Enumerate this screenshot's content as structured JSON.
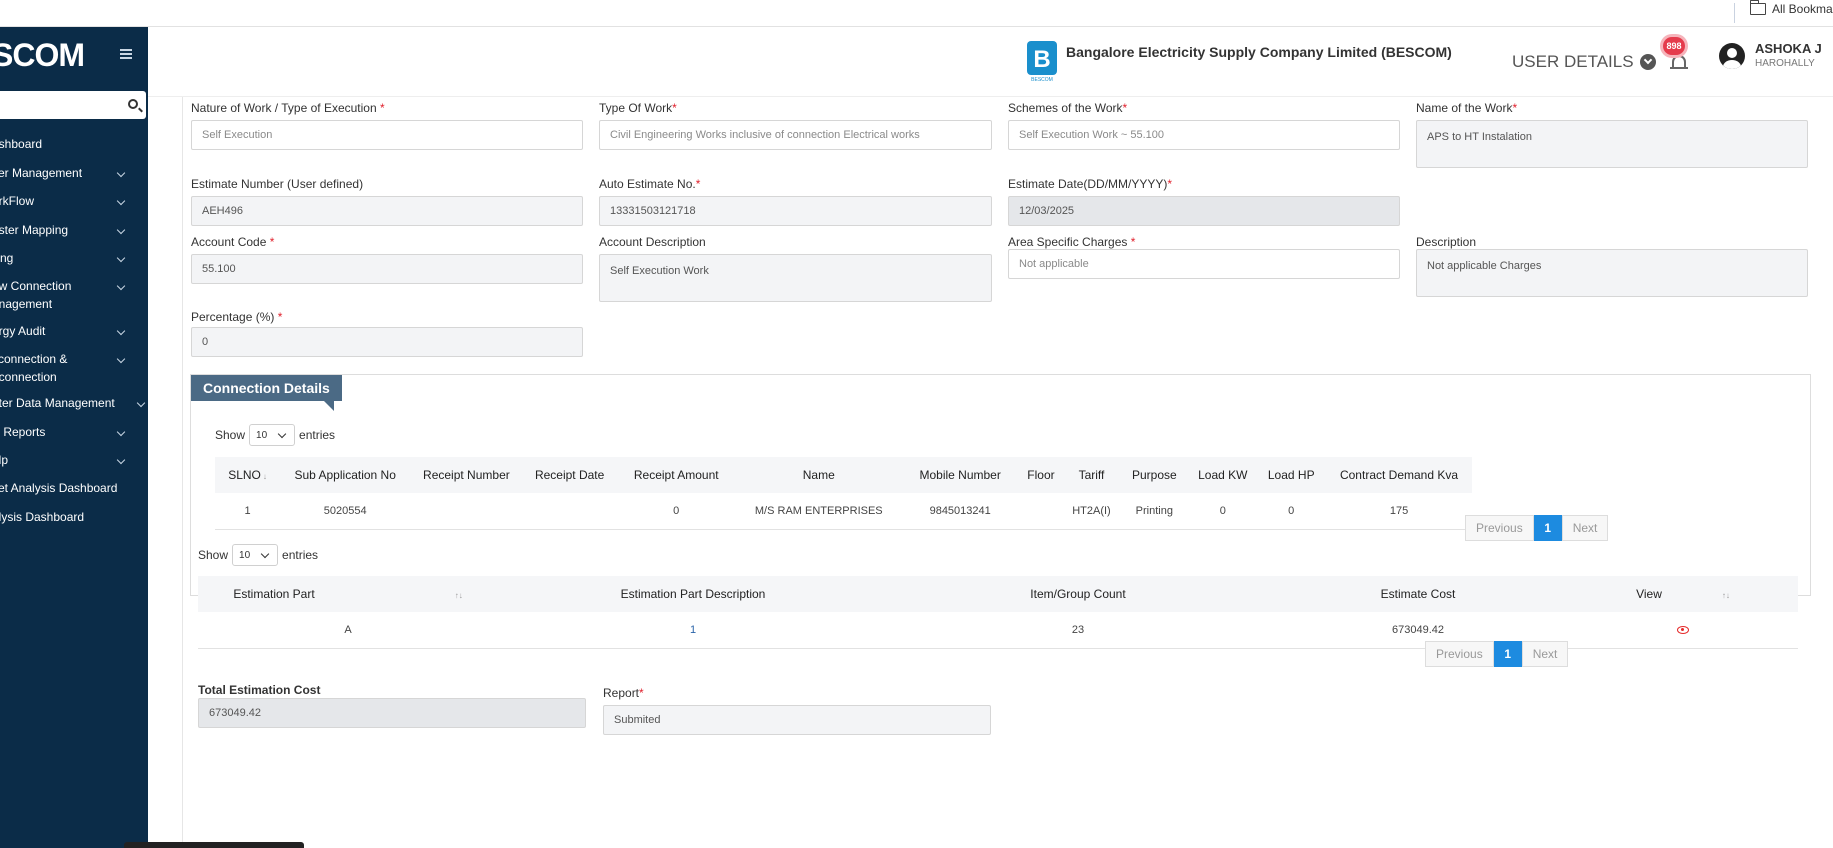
{
  "browser": {
    "bookmarks_folder": "All Bookmarks"
  },
  "sidebar": {
    "brand": "SCOM",
    "search_placeholder": "",
    "items": [
      {
        "label": "ashboard",
        "has_children": false
      },
      {
        "label": "ser Management",
        "has_children": true
      },
      {
        "label": "orkFlow",
        "has_children": true
      },
      {
        "label": "aster Mapping",
        "has_children": true
      },
      {
        "label": "lling",
        "has_children": true
      },
      {
        "label": "ew Connection",
        "label2": "anagement",
        "has_children": true
      },
      {
        "label": "ergy Audit",
        "has_children": true
      },
      {
        "label": "sconnection &",
        "label2": "econnection",
        "has_children": true
      },
      {
        "label": "eter Data Management",
        "has_children": true
      },
      {
        "label": "S Reports",
        "has_children": true
      },
      {
        "label": "elp",
        "has_children": true
      },
      {
        "label": "ket Analysis Dashboard",
        "has_children": false
      },
      {
        "label": "alysis Dashboard",
        "has_children": false
      }
    ]
  },
  "header": {
    "company": "Bangalore Electricity Supply Company Limited (BESCOM)",
    "logo_text": "BESCOM",
    "user_details": "USER DETAILS",
    "notification_count": "898",
    "user_name": "ASHOKA J",
    "user_location": "HAROHALLY"
  },
  "form": {
    "nature_label": "Nature of Work / Type of Execution",
    "nature_value": "Self Execution",
    "type_label": "Type Of Work",
    "type_value": "Civil Engineering Works inclusive of connection Electrical works",
    "scheme_label": "Schemes of the Work",
    "scheme_value": "Self Execution Work ~ 55.100",
    "name_label": "Name of the Work",
    "name_value": "APS to HT Instalation",
    "estno_label": "Estimate Number (User defined)",
    "estno_value": "AEH496",
    "autoest_label": "Auto Estimate No.",
    "autoest_value": "13331503121718",
    "estdate_label": "Estimate Date(DD/MM/YYYY)",
    "estdate_value": "12/03/2025",
    "acc_label": "Account Code",
    "acc_value": "55.100",
    "accdesc_label": "Account Description",
    "accdesc_value": "Self Execution Work",
    "area_label": "Area Specific Charges",
    "area_value": "Not applicable",
    "desc_label": "Description",
    "desc_value": "Not applicable Charges",
    "pct_label": "Percentage (%)",
    "pct_value": "0",
    "required_mark": "*"
  },
  "connection": {
    "title": "Connection Details",
    "show_label": "Show",
    "entries_label": "entries",
    "page_length": "10",
    "columns": [
      "SLNO",
      "Sub Application No",
      "Receipt Number",
      "Receipt Date",
      "Receipt Amount",
      "Name",
      "Mobile Number",
      "Floor",
      "Tariff",
      "Purpose",
      "Load KW",
      "Load HP",
      "Contract Demand Kva"
    ],
    "rows": [
      [
        "1",
        "5020554",
        "",
        "",
        "0",
        "M/S RAM ENTERPRISES",
        "9845013241",
        "",
        "HT2A(I)",
        "Printing",
        "0",
        "0",
        "175"
      ]
    ],
    "prev": "Previous",
    "page": "1",
    "next": "Next"
  },
  "estimation": {
    "show_label": "Show",
    "entries_label": "entries",
    "page_length": "10",
    "columns": [
      "Estimation Part",
      "Estimation Part Description",
      "Item/Group Count",
      "Estimate Cost",
      "View"
    ],
    "rows": [
      [
        "A",
        "1",
        "23",
        "673049.42"
      ]
    ],
    "prev": "Previous",
    "page": "1",
    "next": "Next"
  },
  "totals": {
    "total_label": "Total Estimation Cost",
    "total_value": "673049.42",
    "report_label": "Report",
    "report_value": "Submited"
  },
  "colors": {
    "sidebar_bg": "#0b2c48",
    "panel_title_bg": "#4b6a85",
    "primary": "#1d8be0",
    "required": "#e0202c",
    "badge": "#e53b4c"
  }
}
